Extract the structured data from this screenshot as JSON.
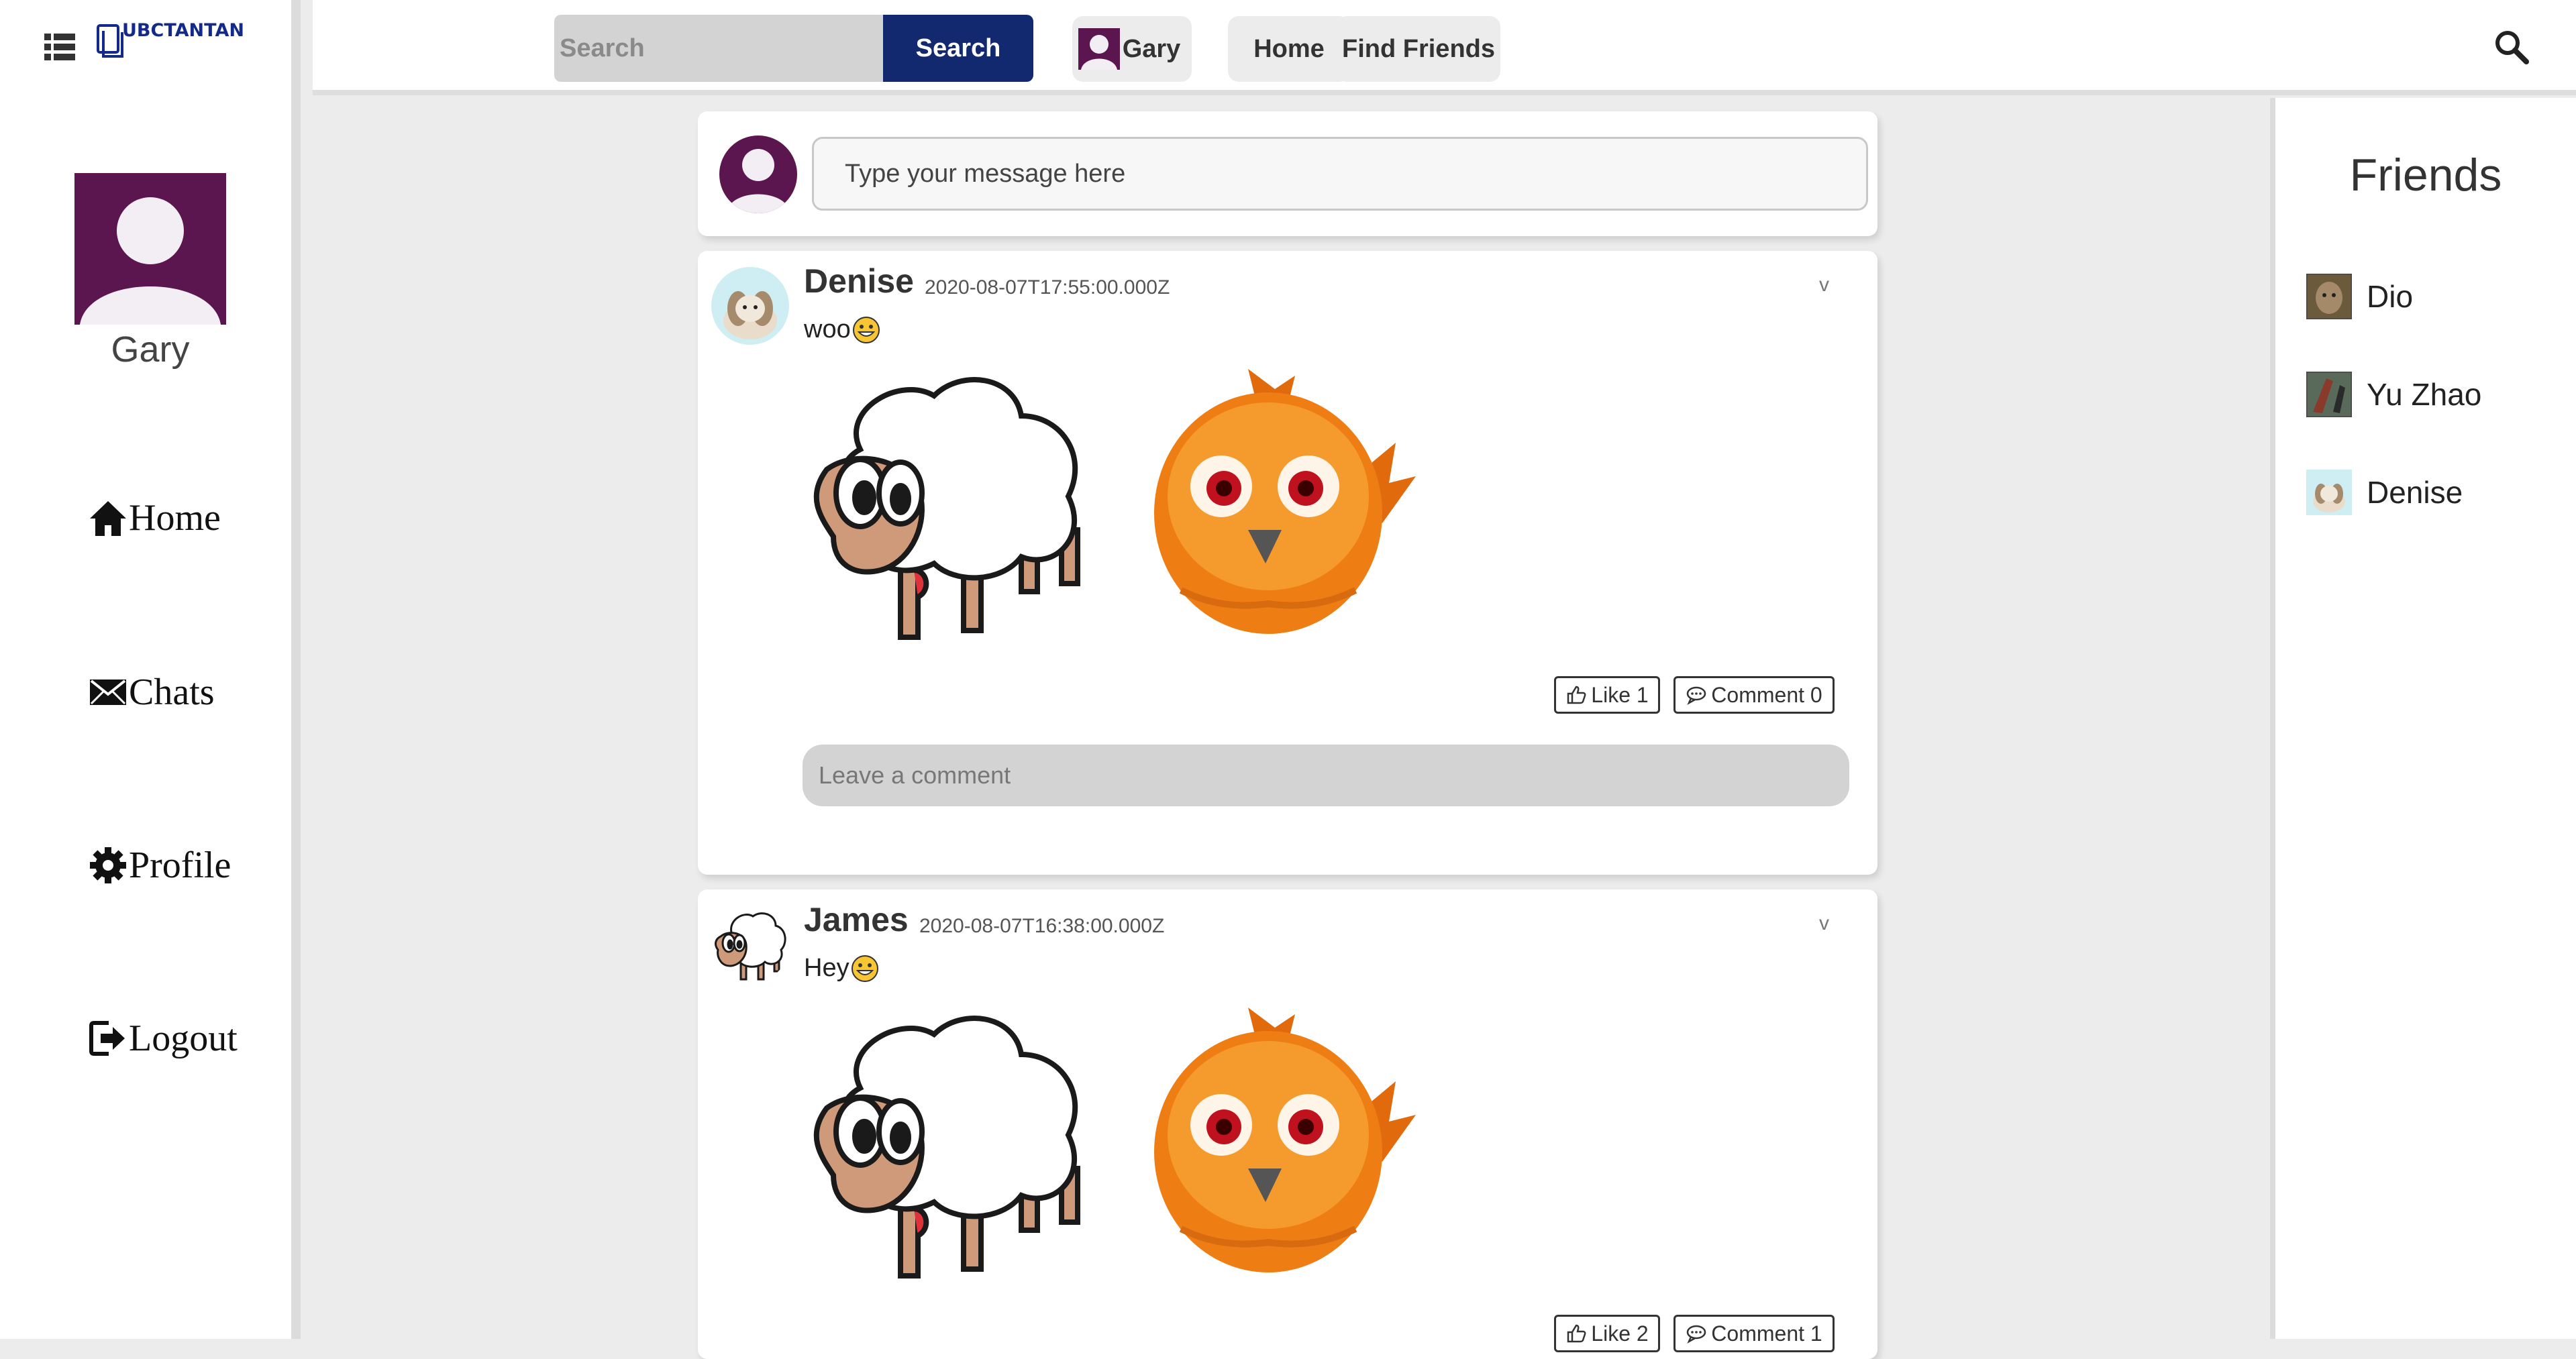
{
  "app": {
    "logo_text": "UBCTANTAN"
  },
  "sidebar": {
    "user_name": "Gary",
    "nav": [
      {
        "label": "Home",
        "icon": "home-icon"
      },
      {
        "label": "Chats",
        "icon": "envelope-icon"
      },
      {
        "label": "Profile",
        "icon": "gear-icon"
      },
      {
        "label": "Logout",
        "icon": "logout-icon"
      }
    ]
  },
  "topbar": {
    "search_placeholder": "Search",
    "search_button": "Search",
    "user_label": "Gary",
    "home_label": "Home",
    "find_friends_label": "Find Friends"
  },
  "composer": {
    "placeholder": "Type your message here"
  },
  "posts": [
    {
      "author": "Denise",
      "timestamp": "2020-08-07T17:55:00.000Z",
      "text": "woo",
      "menu": "v",
      "like_label": "Like 1",
      "comment_label": "Comment 0",
      "comment_placeholder": "Leave a comment"
    },
    {
      "author": "James",
      "timestamp": "2020-08-07T16:38:00.000Z",
      "text": "Hey",
      "menu": "v",
      "like_label": "Like 2",
      "comment_label": "Comment 1"
    }
  ],
  "friends": {
    "title": "Friends",
    "list": [
      {
        "name": "Dio"
      },
      {
        "name": "Yu Zhao"
      },
      {
        "name": "Denise"
      }
    ]
  },
  "colors": {
    "brand_navy": "#13296f",
    "avatar_purple": "#5b1650",
    "logo_blue": "#142a8a"
  }
}
